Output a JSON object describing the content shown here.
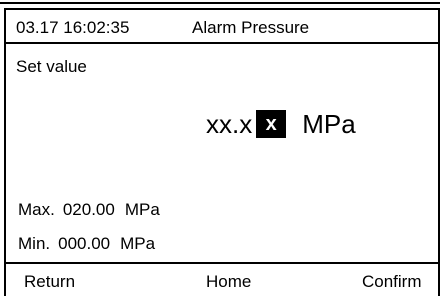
{
  "header": {
    "datetime": "03.17 16:02:35",
    "title": "Alarm Pressure"
  },
  "set_value": {
    "label": "Set value",
    "value_prefix": "xx.x",
    "cursor_digit": "x",
    "unit": "MPa"
  },
  "limits": {
    "max": {
      "label": "Max.",
      "value": "020.00",
      "unit": "MPa"
    },
    "min": {
      "label": "Min.",
      "value": "000.00",
      "unit": "MPa"
    }
  },
  "footer": {
    "return_label": "Return",
    "home_label": "Home",
    "confirm_label": "Confirm"
  },
  "colors": {
    "foreground": "#000000",
    "background": "#ffffff",
    "cursor_bg": "#000000",
    "cursor_fg": "#ffffff"
  }
}
